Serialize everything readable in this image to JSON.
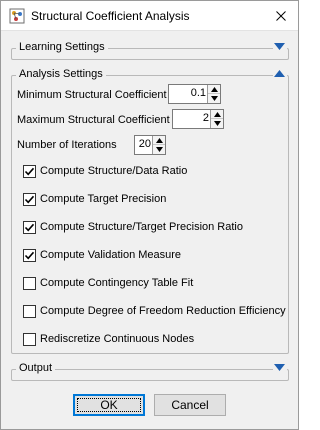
{
  "window": {
    "title": "Structural Coefficient Analysis",
    "close_icon": "close-icon",
    "app_icon": "app-icon"
  },
  "learning_settings": {
    "header": "Learning Settings",
    "expanded": false
  },
  "analysis_settings": {
    "header": "Analysis Settings",
    "expanded": true,
    "min_coefficient": {
      "label": "Minimum Structural Coefficient",
      "value": "0.1"
    },
    "max_coefficient": {
      "label": "Maximum Structural Coefficient",
      "value": "2"
    },
    "iterations": {
      "label": "Number of Iterations",
      "value": "20"
    },
    "options": [
      {
        "label": "Compute Structure/Data Ratio",
        "checked": true
      },
      {
        "label": "Compute Target Precision",
        "checked": true
      },
      {
        "label": "Compute Structure/Target Precision Ratio",
        "checked": true
      },
      {
        "label": "Compute Validation Measure",
        "checked": true
      },
      {
        "label": "Compute Contingency Table Fit",
        "checked": false
      },
      {
        "label": "Compute Degree of Freedom Reduction Efficiency",
        "checked": false
      },
      {
        "label": "Rediscretize Continuous Nodes",
        "checked": false
      }
    ]
  },
  "output": {
    "header": "Output",
    "expanded": false
  },
  "buttons": {
    "ok": "OK",
    "cancel": "Cancel"
  },
  "colors": {
    "accent": "#0078d7",
    "toggle_arrow": "#1f5fb0",
    "window_bg": "#f0f0f0"
  }
}
